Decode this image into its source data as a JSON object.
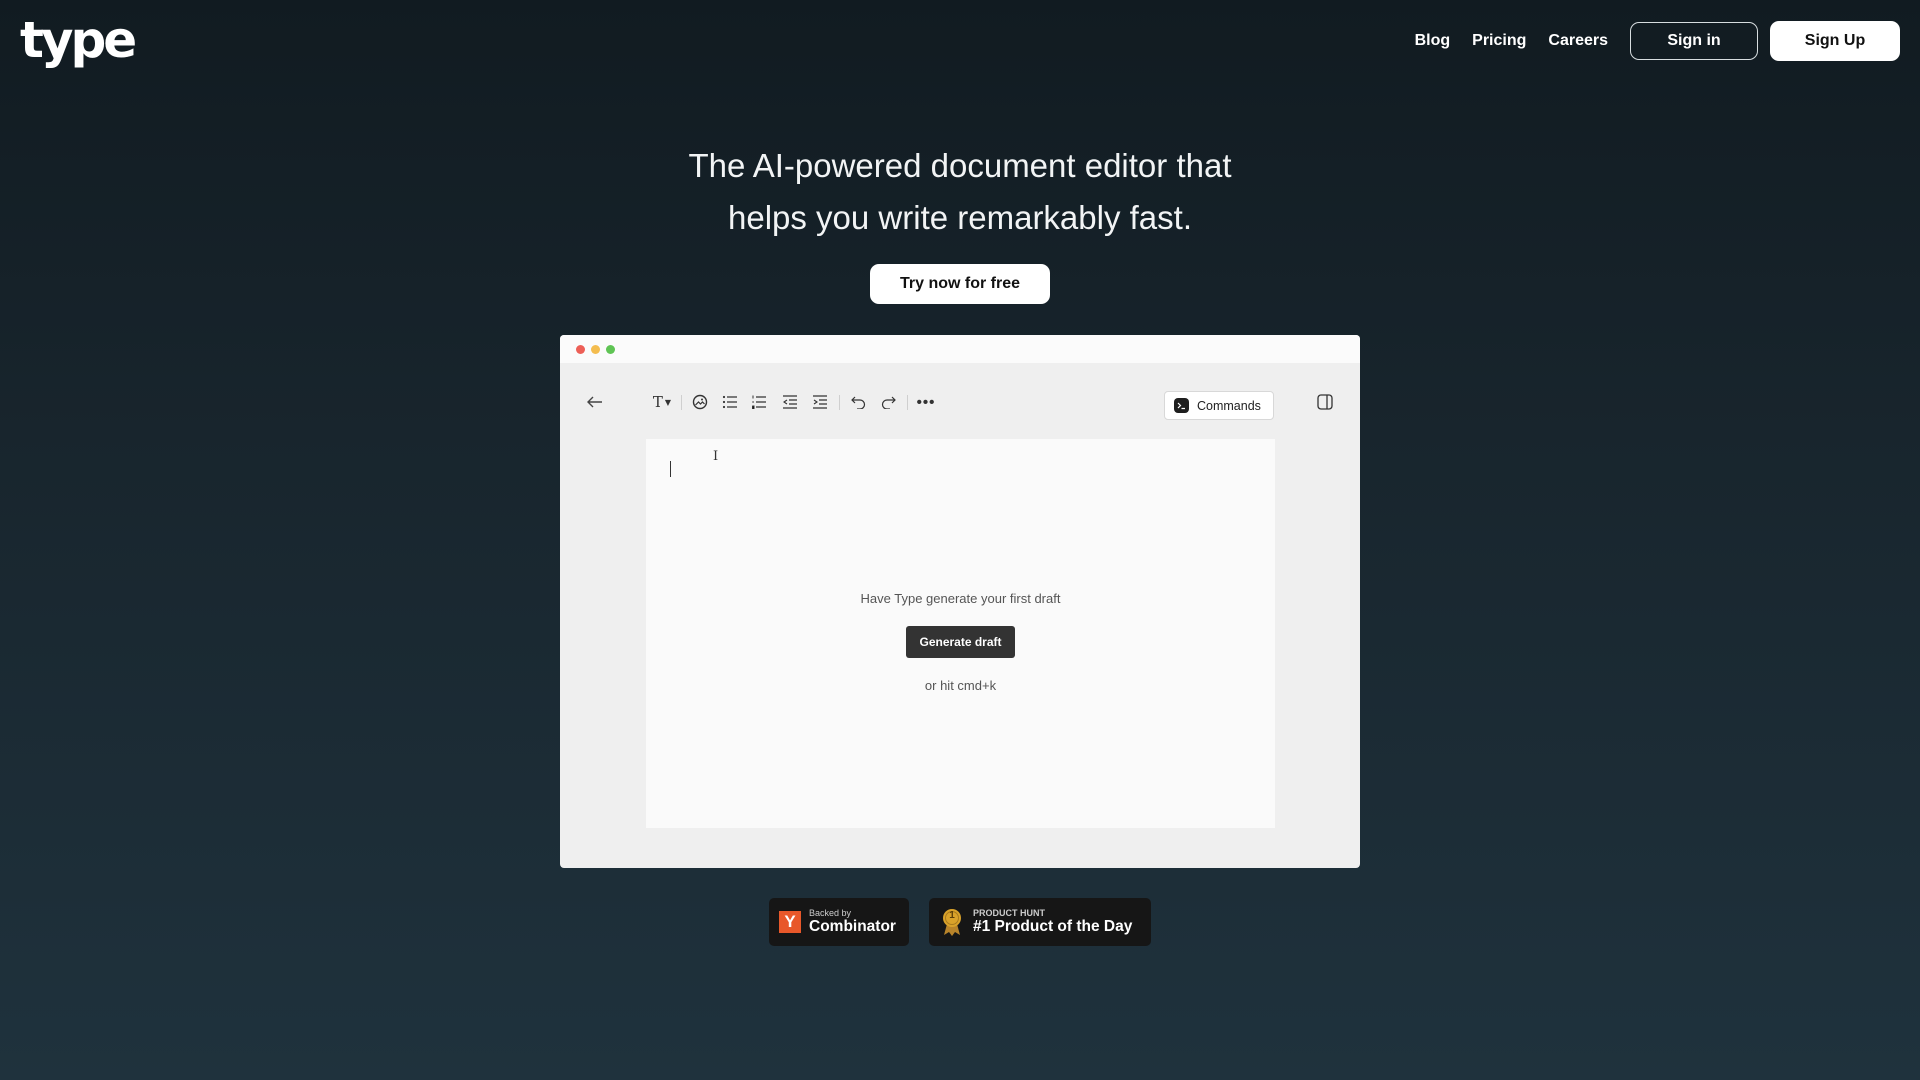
{
  "header": {
    "logo": "type",
    "nav": [
      "Blog",
      "Pricing",
      "Careers"
    ],
    "sign_in": "Sign in",
    "sign_up": "Sign Up"
  },
  "hero": {
    "line1": "The AI-powered document editor that",
    "line2": "helps you write remarkably fast.",
    "cta": "Try now for free"
  },
  "editor": {
    "toolbar_icons": [
      "back-arrow-icon",
      "text-style-icon",
      "image-icon",
      "bullet-list-icon",
      "numbered-list-icon",
      "outdent-icon",
      "indent-icon",
      "undo-icon",
      "redo-icon",
      "more-icon",
      "sidebar-toggle-icon"
    ],
    "commands_label": "Commands",
    "empty_hint": "Have Type generate your first draft",
    "generate_button": "Generate draft",
    "shortcut_hint": "or hit cmd+k"
  },
  "badges": {
    "yc_small": "Backed by",
    "yc_big": "Combinator",
    "yc_letter": "Y",
    "ph_small": "PRODUCT HUNT",
    "ph_big": "#1 Product of the Day",
    "ph_medal_number": "1"
  },
  "colors": {
    "traffic_red": "#ed5f57",
    "traffic_yellow": "#f4bd4f",
    "traffic_green": "#5fc454",
    "yc_orange": "#e8582a",
    "medal_gold": "#d9a22a"
  }
}
